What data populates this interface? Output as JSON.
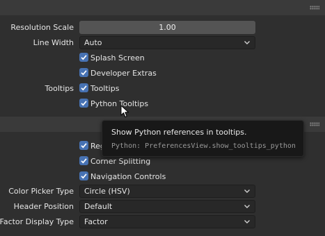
{
  "section1": {
    "resolution_scale": {
      "label": "Resolution Scale",
      "value": "1.00"
    },
    "line_width": {
      "label": "Line Width",
      "value": "Auto"
    },
    "splash_screen": {
      "label": "Splash Screen",
      "checked": true
    },
    "developer_extras": {
      "label": "Developer Extras",
      "checked": true
    },
    "tooltips_group_label": "Tooltips",
    "tooltips": {
      "label": "Tooltips",
      "checked": true
    },
    "python_tooltips": {
      "label": "Python Tooltips",
      "checked": true
    }
  },
  "section2": {
    "region_overlap": {
      "label": "Reg",
      "checked": true
    },
    "corner_splitting": {
      "label": "Corner Splitting",
      "checked": true
    },
    "navigation_controls": {
      "label": "Navigation Controls",
      "checked": true
    },
    "color_picker_type": {
      "label": "Color Picker Type",
      "value": "Circle (HSV)"
    },
    "header_position": {
      "label": "Header Position",
      "value": "Default"
    },
    "factor_display_type": {
      "label": "Factor Display Type",
      "value": "Factor"
    }
  },
  "tooltip": {
    "title": "Show Python references in tooltips.",
    "python": "Python: PreferencesView.show_tooltips_python"
  },
  "colors": {
    "checkbox_accent": "#4772b3",
    "background": "#2b2b2b",
    "tooltip_bg": "#181818"
  },
  "icons": [
    "grip-icon",
    "chevron-down-icon",
    "checkmark-icon",
    "mouse-cursor-icon"
  ]
}
